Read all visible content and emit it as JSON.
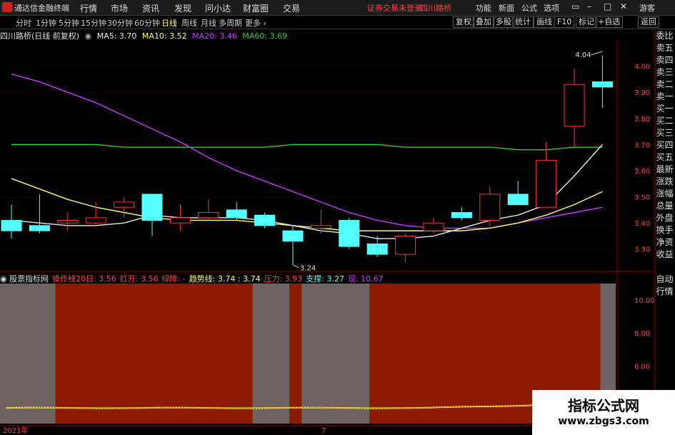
{
  "app": {
    "title": "通达信金融终端"
  },
  "menu": [
    "行情",
    "市场",
    "资讯",
    "发现",
    "问小达",
    "财富圈",
    "交易"
  ],
  "header_right": {
    "login_status": "证券交易未登录",
    "stock_name": "四川路桥",
    "links": [
      "功能",
      "新面",
      "公式",
      "选项"
    ],
    "guest": "游客"
  },
  "periods": [
    {
      "label": "分时",
      "active": false
    },
    {
      "label": "1分钟",
      "active": false
    },
    {
      "label": "5分钟",
      "active": false
    },
    {
      "label": "15分钟",
      "active": false
    },
    {
      "label": "30分钟",
      "active": false
    },
    {
      "label": "60分钟",
      "active": false
    },
    {
      "label": "日线",
      "active": true
    },
    {
      "label": "周线",
      "active": false
    },
    {
      "label": "月线",
      "active": false
    },
    {
      "label": "多周期",
      "active": false
    },
    {
      "label": "更多",
      "active": false
    }
  ],
  "toolbar": [
    "复权",
    "叠加",
    "多股",
    "统计",
    "画线",
    "F10",
    "标记",
    "+自选",
    "返回"
  ],
  "chart_header": {
    "stock": "四川路桥(日线 前复权)",
    "ma5": "MA5: 3.70",
    "ma10": "MA10: 3.52",
    "ma20": "MA20: 3.46",
    "ma60": "MA60: 3.69"
  },
  "side_buttons": [
    "委比",
    "卖五",
    "卖四",
    "卖三",
    "卖二",
    "卖一",
    "买一",
    "买二",
    "买三",
    "买四",
    "买五",
    "最新",
    "涨跌",
    "涨幅",
    "总量",
    "外盘",
    "换手",
    "净资",
    "收益"
  ],
  "side_buttons2": [
    "自动",
    "行情"
  ],
  "colors": {
    "up": "#ff3333",
    "down": "#54ffff",
    "ma5": "#e8e8e8",
    "ma10": "#ffff66",
    "ma20": "#cc33ff",
    "ma60": "#33cc33"
  },
  "chart_data": {
    "type": "candlestick",
    "price_axis": {
      "range": [
        3.22,
        4.1
      ],
      "ticks": [
        "4.00",
        "3.90",
        "3.80",
        "3.70",
        "3.60",
        "3.50",
        "3.40",
        "3.30"
      ]
    },
    "candles": [
      {
        "o": 3.41,
        "h": 3.47,
        "l": 3.34,
        "c": 3.37
      },
      {
        "o": 3.39,
        "h": 3.51,
        "l": 3.36,
        "c": 3.37
      },
      {
        "o": 3.4,
        "h": 3.44,
        "l": 3.37,
        "c": 3.41
      },
      {
        "o": 3.4,
        "h": 3.48,
        "l": 3.39,
        "c": 3.42
      },
      {
        "o": 3.46,
        "h": 3.5,
        "l": 3.42,
        "c": 3.48
      },
      {
        "o": 3.51,
        "h": 3.51,
        "l": 3.35,
        "c": 3.41
      },
      {
        "o": 3.4,
        "h": 3.47,
        "l": 3.37,
        "c": 3.42
      },
      {
        "o": 3.42,
        "h": 3.49,
        "l": 3.41,
        "c": 3.44
      },
      {
        "o": 3.45,
        "h": 3.48,
        "l": 3.41,
        "c": 3.42
      },
      {
        "o": 3.43,
        "h": 3.44,
        "l": 3.38,
        "c": 3.39
      },
      {
        "o": 3.37,
        "h": 3.39,
        "l": 3.24,
        "c": 3.33
      },
      {
        "o": 3.38,
        "h": 3.45,
        "l": 3.36,
        "c": 3.39
      },
      {
        "o": 3.41,
        "h": 3.42,
        "l": 3.3,
        "c": 3.31
      },
      {
        "o": 3.32,
        "h": 3.35,
        "l": 3.27,
        "c": 3.28
      },
      {
        "o": 3.28,
        "h": 3.36,
        "l": 3.25,
        "c": 3.35
      },
      {
        "o": 3.37,
        "h": 3.42,
        "l": 3.36,
        "c": 3.4
      },
      {
        "o": 3.44,
        "h": 3.46,
        "l": 3.41,
        "c": 3.42
      },
      {
        "o": 3.41,
        "h": 3.54,
        "l": 3.39,
        "c": 3.51
      },
      {
        "o": 3.51,
        "h": 3.56,
        "l": 3.47,
        "c": 3.47
      },
      {
        "o": 3.46,
        "h": 3.71,
        "l": 3.46,
        "c": 3.64
      },
      {
        "o": 3.77,
        "h": 3.99,
        "l": 3.69,
        "c": 3.93
      },
      {
        "o": 3.94,
        "h": 4.04,
        "l": 3.84,
        "c": 3.92
      }
    ],
    "ma5": [
      3.41,
      3.4,
      3.39,
      3.39,
      3.4,
      3.43,
      3.42,
      3.42,
      3.42,
      3.41,
      3.39,
      3.37,
      3.36,
      3.34,
      3.34,
      3.35,
      3.38,
      3.41,
      3.43,
      3.47,
      3.58,
      3.7
    ],
    "ma10": [
      3.57,
      3.53,
      3.49,
      3.46,
      3.44,
      3.42,
      3.41,
      3.41,
      3.41,
      3.4,
      3.39,
      3.38,
      3.37,
      3.37,
      3.37,
      3.37,
      3.37,
      3.38,
      3.4,
      3.43,
      3.47,
      3.52
    ],
    "ma20": [
      3.97,
      3.94,
      3.9,
      3.86,
      3.81,
      3.76,
      3.71,
      3.65,
      3.6,
      3.56,
      3.52,
      3.48,
      3.44,
      3.41,
      3.39,
      3.38,
      3.38,
      3.38,
      3.4,
      3.42,
      3.44,
      3.46
    ],
    "ma60": [
      3.7,
      3.7,
      3.7,
      3.7,
      3.69,
      3.69,
      3.69,
      3.69,
      3.69,
      3.69,
      3.7,
      3.7,
      3.7,
      3.7,
      3.69,
      3.69,
      3.69,
      3.69,
      3.68,
      3.68,
      3.69,
      3.69
    ],
    "annotations": {
      "high_label": "4.04",
      "low_label": "3.24"
    },
    "indicator": {
      "name": "股票指标网",
      "items": [
        {
          "label": "操作线20日: 3.56",
          "color": "#ff4040"
        },
        {
          "label": "红开: 3.56",
          "color": "#ff4040"
        },
        {
          "label": "绿降: -",
          "color": "#ff4040"
        },
        {
          "label": "趋势线: 3.74 : 3.74",
          "color": "#ffff66"
        },
        {
          "label": "压力: 3.93",
          "color": "#ff4040"
        },
        {
          "label": "支撑: 3.27",
          "color": "#54ffff"
        },
        {
          "label": "现: 10.67",
          "color": "#cc33ff"
        }
      ],
      "axis_ticks": [
        "10.00",
        "8.00",
        "6.00",
        "4.00"
      ],
      "axis_range": [
        2.5,
        11.0
      ],
      "bg_red_ranges": [
        [
          0.09,
          0.41
        ],
        [
          0.47,
          0.49
        ],
        [
          0.6,
          0.975
        ]
      ]
    },
    "time_axis": {
      "labels": [
        "2021年",
        "7"
      ]
    }
  },
  "watermark": {
    "title": "指标公式网",
    "url": "www.zbgs3.com"
  }
}
